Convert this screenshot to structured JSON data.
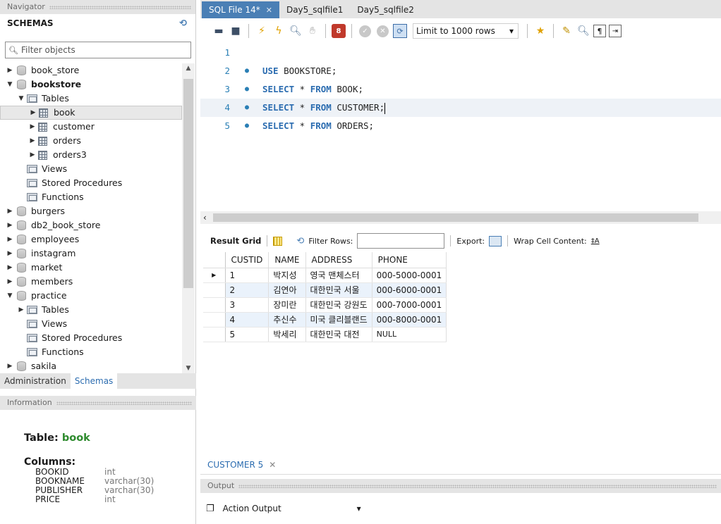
{
  "navigator": {
    "title": "Navigator",
    "schemas_label": "SCHEMAS",
    "filter_placeholder": "Filter objects",
    "tree": [
      {
        "label": "book_store",
        "level": 0,
        "type": "db",
        "arrow": "▶",
        "bold": false
      },
      {
        "label": "bookstore",
        "level": 0,
        "type": "db",
        "arrow": "▼",
        "bold": true
      },
      {
        "label": "Tables",
        "level": 1,
        "type": "folder",
        "arrow": "▼",
        "bold": false
      },
      {
        "label": "book",
        "level": 2,
        "type": "table",
        "arrow": "▶",
        "bold": false,
        "selected": true
      },
      {
        "label": "customer",
        "level": 2,
        "type": "table",
        "arrow": "▶",
        "bold": false
      },
      {
        "label": "orders",
        "level": 2,
        "type": "table",
        "arrow": "▶",
        "bold": false
      },
      {
        "label": "orders3",
        "level": 2,
        "type": "table",
        "arrow": "▶",
        "bold": false
      },
      {
        "label": "Views",
        "level": 1,
        "type": "folder",
        "arrow": "",
        "bold": false
      },
      {
        "label": "Stored Procedures",
        "level": 1,
        "type": "folder",
        "arrow": "",
        "bold": false
      },
      {
        "label": "Functions",
        "level": 1,
        "type": "folder",
        "arrow": "",
        "bold": false
      },
      {
        "label": "burgers",
        "level": 0,
        "type": "db",
        "arrow": "▶",
        "bold": false
      },
      {
        "label": "db2_book_store",
        "level": 0,
        "type": "db",
        "arrow": "▶",
        "bold": false
      },
      {
        "label": "employees",
        "level": 0,
        "type": "db",
        "arrow": "▶",
        "bold": false
      },
      {
        "label": "instagram",
        "level": 0,
        "type": "db",
        "arrow": "▶",
        "bold": false
      },
      {
        "label": "market",
        "level": 0,
        "type": "db",
        "arrow": "▶",
        "bold": false
      },
      {
        "label": "members",
        "level": 0,
        "type": "db",
        "arrow": "▶",
        "bold": false
      },
      {
        "label": "practice",
        "level": 0,
        "type": "db",
        "arrow": "▼",
        "bold": false
      },
      {
        "label": "Tables",
        "level": 1,
        "type": "folder",
        "arrow": "▶",
        "bold": false
      },
      {
        "label": "Views",
        "level": 1,
        "type": "folder",
        "arrow": "",
        "bold": false
      },
      {
        "label": "Stored Procedures",
        "level": 1,
        "type": "folder",
        "arrow": "",
        "bold": false
      },
      {
        "label": "Functions",
        "level": 1,
        "type": "folder",
        "arrow": "",
        "bold": false
      },
      {
        "label": "sakila",
        "level": 0,
        "type": "db",
        "arrow": "▶",
        "bold": false
      }
    ],
    "bottom_tabs": [
      "Administration",
      "Schemas"
    ],
    "active_bottom_tab": 1
  },
  "information": {
    "title": "Information",
    "table_prefix": "Table:",
    "table_name": "book",
    "columns_label": "Columns:",
    "columns": [
      {
        "name": "BOOKID",
        "type": "int"
      },
      {
        "name": "BOOKNAME",
        "type": "varchar(30)"
      },
      {
        "name": "PUBLISHER",
        "type": "varchar(30)"
      },
      {
        "name": "PRICE",
        "type": "int"
      }
    ]
  },
  "editor_tabs": [
    {
      "label": "SQL File 14*",
      "active": true,
      "closable": true
    },
    {
      "label": "Day5_sqlfile1",
      "active": false,
      "closable": false
    },
    {
      "label": "Day5_sqlfile2",
      "active": false,
      "closable": false
    }
  ],
  "toolbar": {
    "limit_label": "Limit to 1000 rows"
  },
  "code": [
    {
      "num": "1",
      "dot": false,
      "tokens": []
    },
    {
      "num": "2",
      "dot": true,
      "tokens": [
        {
          "t": "kw",
          "v": "USE"
        },
        {
          "t": "id",
          "v": " BOOKSTORE;"
        }
      ]
    },
    {
      "num": "3",
      "dot": true,
      "tokens": [
        {
          "t": "kw",
          "v": "SELECT"
        },
        {
          "t": "id",
          "v": " * "
        },
        {
          "t": "kw",
          "v": "FROM"
        },
        {
          "t": "id",
          "v": " BOOK;"
        }
      ]
    },
    {
      "num": "4",
      "dot": true,
      "current": true,
      "tokens": [
        {
          "t": "kw",
          "v": "SELECT"
        },
        {
          "t": "id",
          "v": " * "
        },
        {
          "t": "kw",
          "v": "FROM"
        },
        {
          "t": "id",
          "v": " CUSTOMER;"
        }
      ]
    },
    {
      "num": "5",
      "dot": true,
      "tokens": [
        {
          "t": "kw",
          "v": "SELECT"
        },
        {
          "t": "id",
          "v": " * "
        },
        {
          "t": "kw",
          "v": "FROM"
        },
        {
          "t": "id",
          "v": " ORDERS;"
        }
      ]
    }
  ],
  "result_bar": {
    "result_grid_label": "Result Grid",
    "filter_rows_label": "Filter Rows:",
    "export_label": "Export:",
    "wrap_label": "Wrap Cell Content:",
    "wrap_icon": "‡A"
  },
  "grid": {
    "columns": [
      "CUSTID",
      "NAME",
      "ADDRESS",
      "PHONE"
    ],
    "rows": [
      [
        "1",
        "박지성",
        "영국 맨체스터",
        "000-5000-0001"
      ],
      [
        "2",
        "김연아",
        "대한민국 서울",
        "000-6000-0001"
      ],
      [
        "3",
        "장미란",
        "대한민국 강원도",
        "000-7000-0001"
      ],
      [
        "4",
        "추신수",
        "미국 클리블랜드",
        "000-8000-0001"
      ],
      [
        "5",
        "박세리",
        "대한민국 대전",
        "NULL"
      ]
    ]
  },
  "result_tab": {
    "label": "CUSTOMER 5"
  },
  "output": {
    "title": "Output",
    "selector": "Action Output"
  },
  "colors": {
    "accent": "#4a7fb5",
    "keyword": "#2b6cb0",
    "table_name": "#2d8a2d",
    "alt_row": "#eaf2fb"
  }
}
